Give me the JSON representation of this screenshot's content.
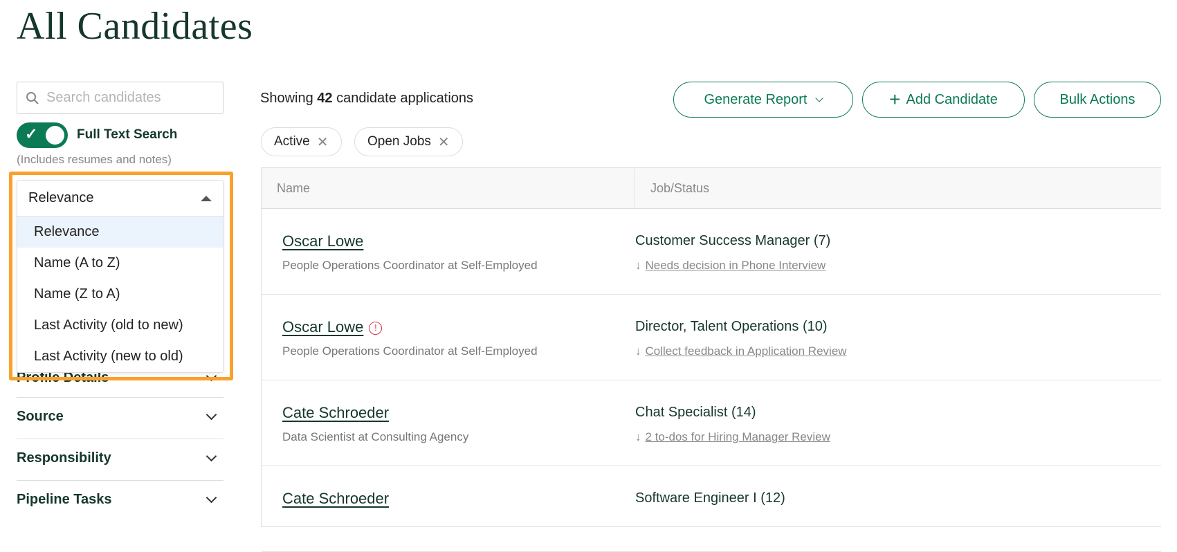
{
  "page": {
    "title": "All Candidates"
  },
  "sidebar": {
    "search_placeholder": "Search candidates",
    "full_text_search": {
      "label": "Full Text Search",
      "enabled": true,
      "note": "(Includes resumes and notes)"
    },
    "sort": {
      "selected": "Relevance",
      "options": [
        "Relevance",
        "Name (A to Z)",
        "Name (Z to A)",
        "Last Activity (old to new)",
        "Last Activity (new to old)"
      ]
    },
    "facets": [
      "Profile Details",
      "Source",
      "Responsibility",
      "Pipeline Tasks"
    ],
    "highlight_color": "#f9a12d"
  },
  "main": {
    "showing_prefix": "Showing ",
    "showing_count": "42",
    "showing_suffix": " candidate applications",
    "buttons": {
      "generate_report": "Generate Report",
      "add_candidate": "Add Candidate",
      "bulk_actions": "Bulk Actions"
    },
    "filters": [
      "Active",
      "Open Jobs"
    ],
    "table": {
      "headers": [
        "Name",
        "Job/Status"
      ],
      "rows": [
        {
          "name": "Oscar Lowe",
          "subtitle": "People Operations Coordinator at Self-Employed",
          "job": "Customer Success Manager (7)",
          "status": "Needs decision in Phone Interview",
          "warning": false
        },
        {
          "name": "Oscar Lowe",
          "subtitle": "People Operations Coordinator at Self-Employed",
          "job": "Director, Talent Operations (10)",
          "status": "Collect feedback in Application Review",
          "warning": true
        },
        {
          "name": "Cate Schroeder",
          "subtitle": "Data Scientist at Consulting Agency",
          "job": "Chat Specialist (14)",
          "status": "2 to-dos for Hiring Manager Review",
          "warning": false
        },
        {
          "name": "Cate Schroeder",
          "subtitle": "",
          "job": "Software Engineer I (12)",
          "status": "",
          "warning": false
        }
      ]
    }
  },
  "colors": {
    "brand": "#0b7a55",
    "heading": "#15372c",
    "warning": "#d9304f"
  }
}
